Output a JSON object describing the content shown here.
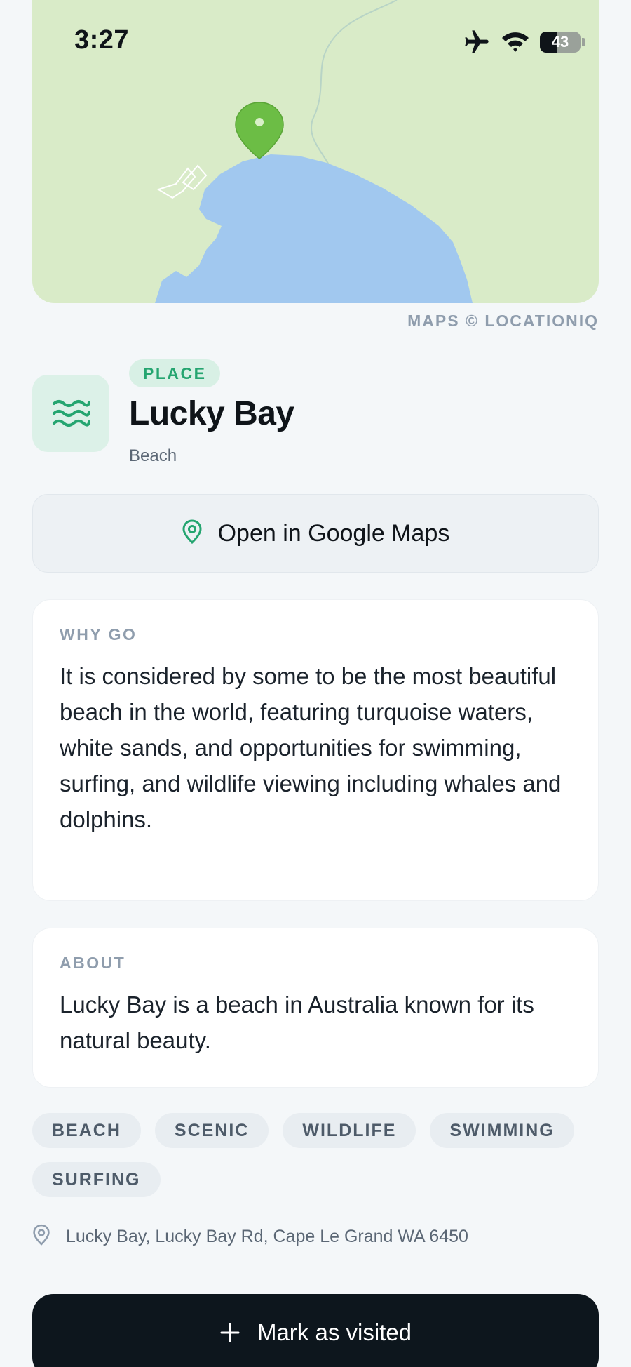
{
  "status_bar": {
    "time": "3:27",
    "battery_level": "43",
    "battery_fraction": 0.43
  },
  "map": {
    "attribution": "MAPS © LOCATIONIQ",
    "colors": {
      "land": "#d9ebc8",
      "water": "#a1c8ef",
      "marker": "#6cbd45"
    },
    "marker_icon": "map-pin-icon"
  },
  "place": {
    "badge": "PLACE",
    "name": "Lucky Bay",
    "category": "Beach",
    "icon": "waves-icon",
    "accent_color": "#25a570"
  },
  "actions": {
    "open_maps_label": "Open in Google Maps",
    "mark_visited_label": "Mark as visited"
  },
  "why_go": {
    "label": "WHY GO",
    "text": "It is considered by some to be the most beautiful beach in the world, featuring turquoise waters, white sands, and opportunities for swimming, surfing, and wildlife viewing including whales and dolphins."
  },
  "about": {
    "label": "ABOUT",
    "text": "Lucky Bay is a beach in Australia known for its natural beauty."
  },
  "tags": [
    "BEACH",
    "SCENIC",
    "WILDLIFE",
    "SWIMMING",
    "SURFING"
  ],
  "address": "Lucky Bay, Lucky Bay Rd, Cape Le Grand WA 6450"
}
